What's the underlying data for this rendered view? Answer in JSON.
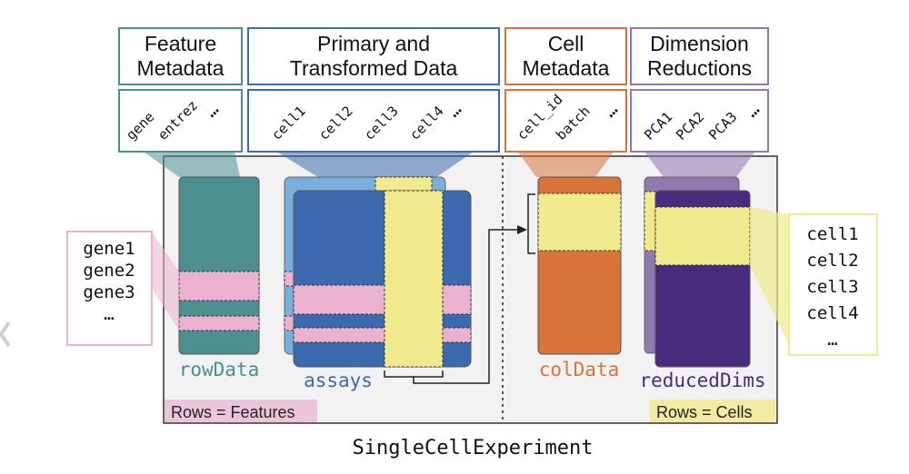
{
  "title": "SingleCellExperiment",
  "colors": {
    "rowData": "#4b8f91",
    "assays_back": "#7aaedc",
    "assays_front": "#3d6aae",
    "colData": "#d8743a",
    "reduced_back": "#9079ae",
    "reduced_front": "#482d7e",
    "highlight_pink": "#ebb2d0",
    "highlight_yellow": "#f0ea8c",
    "panel_bg": "#f2f2f2"
  },
  "headers": [
    {
      "id": "feature",
      "title": [
        "Feature",
        "Metadata"
      ],
      "columns": [
        "gene",
        "entrez",
        "..."
      ],
      "color": "#4b8f91"
    },
    {
      "id": "primary",
      "title": [
        "Primary and",
        "Transformed Data"
      ],
      "columns": [
        "cell1",
        "cell2",
        "cell3",
        "cell4",
        "..."
      ],
      "color": "#3d6aae"
    },
    {
      "id": "cellmeta",
      "title": [
        "Cell",
        "Metadata"
      ],
      "columns": [
        "cell_id",
        "batch",
        "..."
      ],
      "color": "#d8743a"
    },
    {
      "id": "dimred",
      "title": [
        "Dimension",
        "Reductions"
      ],
      "columns": [
        "PCA1",
        "PCA2",
        "PCA3",
        "..."
      ],
      "color": "#9079ae"
    }
  ],
  "slots": {
    "rowData": "rowData",
    "assays": "assays",
    "colData": "colData",
    "reducedDims": "reducedDims"
  },
  "gene_list": [
    "gene1",
    "gene2",
    "gene3",
    "..."
  ],
  "cell_list": [
    "cell1",
    "cell2",
    "cell3",
    "cell4",
    "..."
  ],
  "tags": {
    "rows_features": "Rows = Features",
    "rows_cells": "Rows = Cells"
  }
}
